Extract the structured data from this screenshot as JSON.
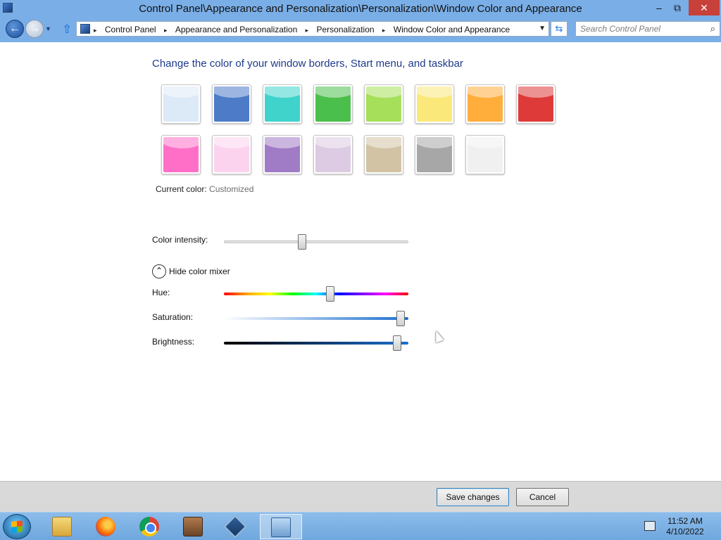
{
  "window": {
    "title": "Control Panel\\Appearance and Personalization\\Personalization\\Window Color and Appearance",
    "min_glyph": "‒",
    "max_glyph": "⧉",
    "close_glyph": "✕"
  },
  "nav": {
    "back_glyph": "←",
    "forward_glyph": "→",
    "recent_glyph": "▼",
    "up_glyph": "⇧",
    "refresh_glyph": "⇆",
    "address_dropdown_glyph": "▼",
    "breadcrumbs": [
      "Control Panel",
      "Appearance and Personalization",
      "Personalization",
      "Window Color and Appearance"
    ],
    "separator_glyph": "▸",
    "search_placeholder": "Search Control Panel",
    "search_icon_glyph": "⌕"
  },
  "main": {
    "heading": "Change the color of your window borders, Start menu, and taskbar",
    "swatches": [
      {
        "name": "sky",
        "color": "#dce9f7"
      },
      {
        "name": "twilight",
        "color": "#4d7bc8"
      },
      {
        "name": "sea",
        "color": "#3fd3cc"
      },
      {
        "name": "leaf",
        "color": "#4bbf4b"
      },
      {
        "name": "lime",
        "color": "#a6e05a"
      },
      {
        "name": "lemon",
        "color": "#fbe87a"
      },
      {
        "name": "pumpkin",
        "color": "#ffae3c"
      },
      {
        "name": "ruby",
        "color": "#df3a3a"
      },
      {
        "name": "fuchsia",
        "color": "#ff6fc7"
      },
      {
        "name": "blush",
        "color": "#fcd3ee"
      },
      {
        "name": "violet",
        "color": "#a07bc6"
      },
      {
        "name": "lavender",
        "color": "#dccbe2"
      },
      {
        "name": "taupe",
        "color": "#d1c3a3"
      },
      {
        "name": "chocolate",
        "color": "#a7a7a7"
      },
      {
        "name": "slate",
        "color": "#f0f0f0"
      }
    ],
    "current_color_label": "Current color:",
    "current_color_value": "Customized",
    "intensity_label": "Color intensity:",
    "intensity_value": 0.42,
    "mixer_toggle_glyph": "⌃",
    "mixer_toggle_label": "Hide color mixer",
    "hue_label": "Hue:",
    "hue_value": 0.58,
    "saturation_label": "Saturation:",
    "saturation_value": 0.98,
    "brightness_label": "Brightness:",
    "brightness_value": 0.96
  },
  "buttons": {
    "save": "Save changes",
    "cancel": "Cancel"
  },
  "taskbar": {
    "pinned": [
      "explorer",
      "firefox",
      "chrome",
      "winrar",
      "virtualbox",
      "control-panel"
    ],
    "time": "11:52 AM",
    "date": "4/10/2022"
  }
}
